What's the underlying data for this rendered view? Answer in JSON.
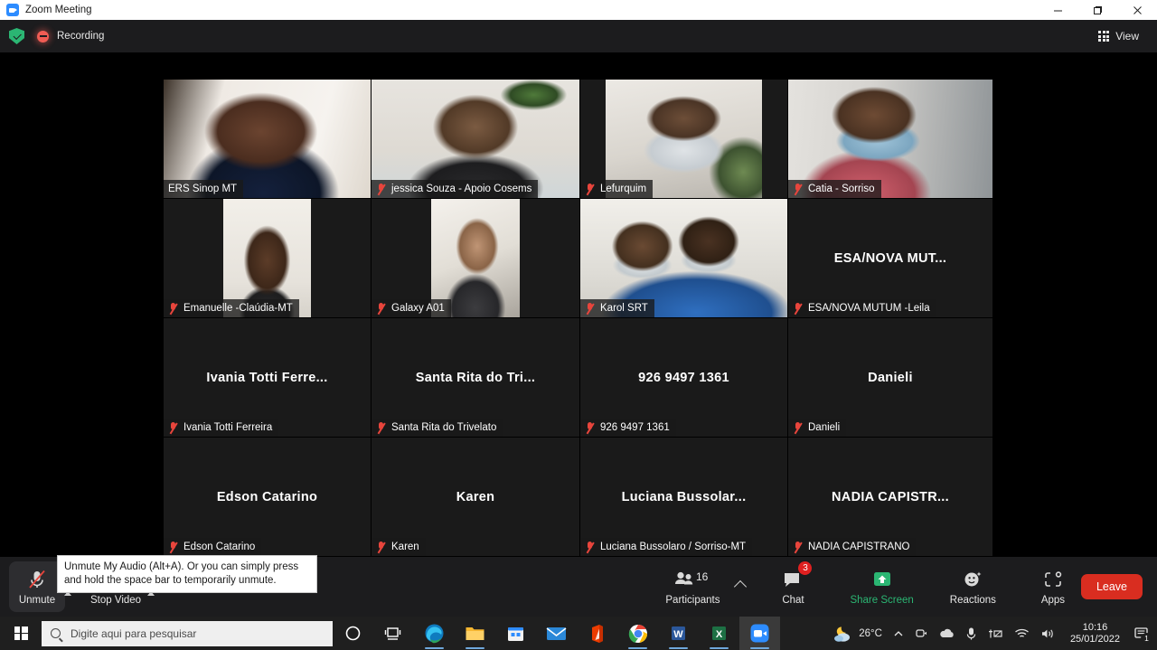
{
  "window": {
    "title": "Zoom Meeting",
    "app_icon": "zoom-camera-icon",
    "minimize": "–",
    "maximize": "❐",
    "close": "✕"
  },
  "header": {
    "security_icon": "shield-check-icon",
    "recording_icon": "recording-stop-icon",
    "recording_label": "Recording",
    "view_label": "View",
    "view_icon": "grid-icon"
  },
  "gallery": {
    "tiles": [
      {
        "name": "ERS Sinop MT",
        "display_name": "ERS Sinop MT",
        "muted": false,
        "video": true,
        "active": false,
        "photo": "ph-a"
      },
      {
        "name": "jessica Souza - Apoio Cosems",
        "display_name": "jessica Souza - Apoio Cosems",
        "muted": true,
        "video": true,
        "active": true,
        "photo": "ph-b"
      },
      {
        "name": "Lefurquim",
        "display_name": "Lefurquim",
        "muted": true,
        "video": true,
        "active": false,
        "photo": "ph-c"
      },
      {
        "name": "Catia - Sorriso",
        "display_name": "Catia - Sorriso",
        "muted": true,
        "video": true,
        "active": false,
        "photo": "ph-d"
      },
      {
        "name": "Emanuelle -Claúdia-MT",
        "display_name": "Emanuelle -Claúdia-MT",
        "muted": true,
        "video": true,
        "active": false,
        "photo": "ph-e"
      },
      {
        "name": "Galaxy A01",
        "display_name": "Galaxy A01",
        "muted": true,
        "video": true,
        "active": false,
        "photo": "ph-f"
      },
      {
        "name": "Karol SRT",
        "display_name": "Karol SRT",
        "muted": true,
        "video": true,
        "active": false,
        "photo": "ph-g"
      },
      {
        "name": "ESA/NOVA MUTUM -Leila",
        "display_name": "ESA/NOVA MUTUM -Leila",
        "avatar_label": "ESA/NOVA MUT...",
        "muted": true,
        "video": false,
        "active": false
      },
      {
        "name": "Ivania Totti Ferreira",
        "display_name": "Ivania Totti Ferreira",
        "avatar_label": "Ivania Totti Ferre...",
        "muted": true,
        "video": false,
        "active": false
      },
      {
        "name": "Santa Rita do Trivelato",
        "display_name": "Santa Rita do Trivelato",
        "avatar_label": "Santa Rita do Tri...",
        "muted": true,
        "video": false,
        "active": false
      },
      {
        "name": "926 9497 1361",
        "display_name": "926 9497 1361",
        "avatar_label": "926 9497 1361",
        "muted": true,
        "video": false,
        "active": false
      },
      {
        "name": "Danieli",
        "display_name": "Danieli",
        "avatar_label": "Danieli",
        "muted": true,
        "video": false,
        "active": false
      },
      {
        "name": "Edson Catarino",
        "display_name": "Edson Catarino",
        "avatar_label": "Edson Catarino",
        "muted": true,
        "video": false,
        "active": false
      },
      {
        "name": "Karen",
        "display_name": "Karen",
        "avatar_label": "Karen",
        "muted": true,
        "video": false,
        "active": false
      },
      {
        "name": "Luciana Bussolaro / Sorriso-MT",
        "display_name": "Luciana Bussolaro / Sorriso-MT",
        "avatar_label": "Luciana  Bussolar...",
        "muted": true,
        "video": false,
        "active": false
      },
      {
        "name": "NADIA CAPISTRANO",
        "display_name": "NADIA CAPISTRANO",
        "avatar_label": "NADIA  CAPISTR...",
        "muted": true,
        "video": false,
        "active": false
      }
    ]
  },
  "tooltip": {
    "text": "Unmute My Audio (Alt+A). Or you can simply press and hold the space bar to temporarily unmute."
  },
  "toolbar": {
    "unmute_label": "Unmute",
    "unmute_icon": "mic-muted-icon",
    "stop_video_label": "Stop Video",
    "stop_video_icon": "camera-icon",
    "participants_label": "Participants",
    "participants_icon": "people-icon",
    "participants_count": "16",
    "chat_label": "Chat",
    "chat_icon": "chat-bubble-icon",
    "chat_badge": "3",
    "share_screen_label": "Share Screen",
    "share_screen_icon": "share-up-arrow-icon",
    "reactions_label": "Reactions",
    "reactions_icon": "smiley-icon",
    "apps_label": "Apps",
    "apps_icon": "apps-bracket-icon",
    "leave_label": "Leave",
    "share_color": "#2bb673",
    "leave_color": "#d92d20"
  },
  "taskbar": {
    "start_icon": "windows-logo-icon",
    "search_placeholder": "Digite aqui para pesquisar",
    "search_icon": "search-icon",
    "apps": [
      {
        "name": "cortana-icon",
        "label": ""
      },
      {
        "name": "task-view-icon",
        "label": ""
      },
      {
        "name": "edge-icon",
        "label": ""
      },
      {
        "name": "file-explorer-icon",
        "label": ""
      },
      {
        "name": "microsoft-store-icon",
        "label": ""
      },
      {
        "name": "mail-icon",
        "label": ""
      },
      {
        "name": "office-icon",
        "label": ""
      },
      {
        "name": "chrome-icon",
        "label": ""
      },
      {
        "name": "word-icon",
        "label": "W"
      },
      {
        "name": "excel-icon",
        "label": "X"
      },
      {
        "name": "zoom-icon",
        "label": ""
      }
    ],
    "tray": {
      "weather_icon": "partly-cloudy-night-icon",
      "weather_temp": "26°C",
      "chevron_icon": "chevron-up-icon",
      "zoom_tray_icon": "zoom-tray-icon",
      "onedrive_icon": "onedrive-icon",
      "mic_icon": "microphone-icon",
      "hardware_icon": "device-icon",
      "wifi_icon": "wifi-icon",
      "volume_icon": "speaker-icon",
      "time": "10:16",
      "date": "25/01/2022",
      "notification_icon": "notification-icon",
      "notification_count": "1"
    }
  }
}
